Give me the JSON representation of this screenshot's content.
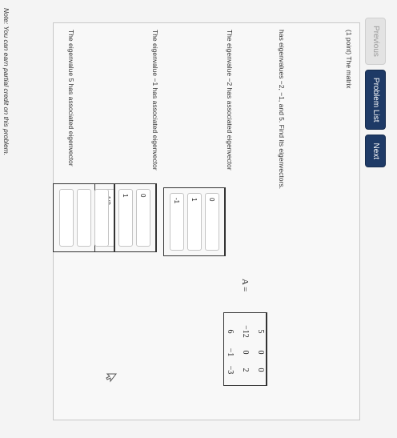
{
  "nav": {
    "previous": "Previous",
    "problem_list": "Problem List",
    "next": "Next"
  },
  "problem": {
    "intro": "(1 point) The matrix",
    "eigen_text": "has eigenvalues −2, −1, and 5. Find its eigenvectors.",
    "matrix_label": "A =",
    "matrix_rows": [
      [
        "5",
        "0",
        "0"
      ],
      [
        "−12",
        "0",
        "2"
      ],
      [
        "6",
        "−1",
        "−3"
      ]
    ]
  },
  "eigen_minus2": {
    "label": "The eigenvalue −2 has associated eigenvector",
    "values": [
      "0",
      "1",
      "-1"
    ]
  },
  "eigen_minus1": {
    "label": "The eigenvalue −1 has associated eigenvector",
    "values": [
      "0",
      "1",
      "-1/2"
    ]
  },
  "eigen_5": {
    "label": "The eigenvalue 5 has associated eigenvector",
    "values": [
      "",
      "",
      ""
    ]
  },
  "note": "Note: You can earn partial credit on this problem."
}
